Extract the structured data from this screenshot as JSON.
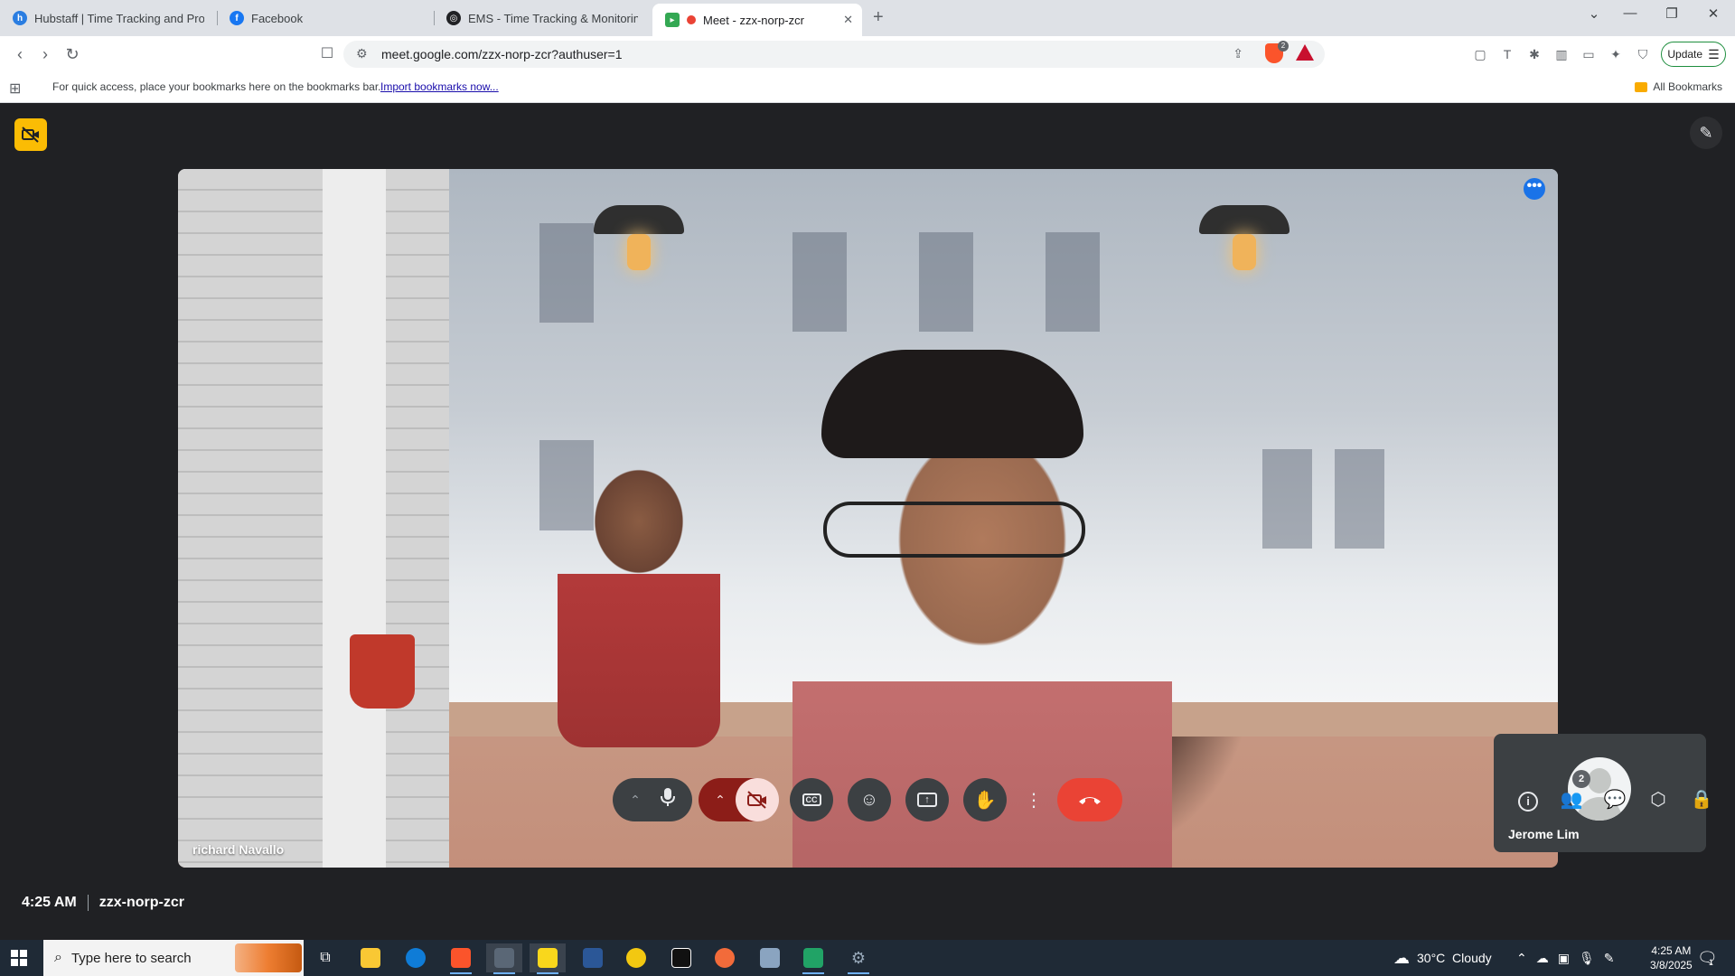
{
  "browser": {
    "tabs": [
      {
        "title": "Hubstaff | Time Tracking and Produ",
        "icon": "hubstaff-icon"
      },
      {
        "title": "Facebook",
        "icon": "facebook-icon"
      },
      {
        "title": "EMS - Time Tracking & Monitoring",
        "icon": "ems-icon"
      },
      {
        "title": "Meet - zzx-norp-zcr",
        "icon": "meet-icon",
        "active": true
      }
    ],
    "url": "meet.google.com/zzx-norp-zcr?authuser=1",
    "update_label": "Update",
    "bookmarks_message": "For quick access, place your bookmarks here on the bookmarks bar.",
    "import_bookmarks": "Import bookmarks now...",
    "all_bookmarks": "All Bookmarks",
    "brave_badge": "2"
  },
  "meet": {
    "main_participant": "richard Navallo",
    "self_participant": "Jerome Lim",
    "time": "4:25 AM",
    "meeting_code": "zzx-norp-zcr",
    "people_count": "2"
  },
  "taskbar": {
    "search_placeholder": "Type here to search",
    "weather": "30°C  Cloudy",
    "time": "4:25 AM",
    "date": "3/8/2025",
    "notification_count": "1"
  },
  "colors": {
    "meet_background": "#202124",
    "end_call_red": "#ea4335",
    "camera_off_pink": "#f9dedc",
    "badge_yellow": "#fbbc04",
    "more_blue": "#1a73e8"
  }
}
